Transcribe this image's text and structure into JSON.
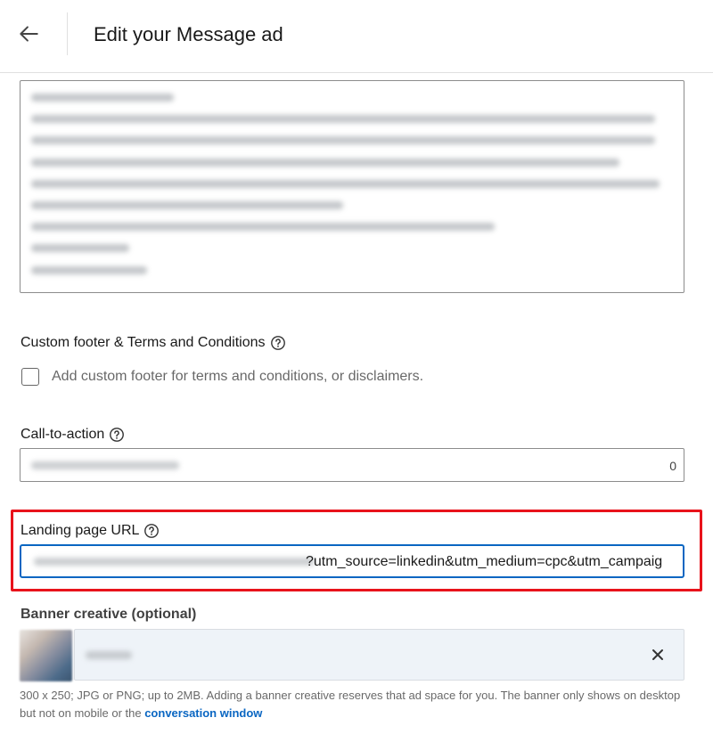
{
  "header": {
    "title": "Edit your Message ad",
    "back_icon": "arrow-left-icon"
  },
  "custom_footer": {
    "label": "Custom footer & Terms and Conditions",
    "checkbox_label": "Add custom footer for terms and conditions, or disclaimers.",
    "checked": false
  },
  "call_to_action": {
    "label": "Call-to-action",
    "char_count": "0"
  },
  "landing_page": {
    "label": "Landing page URL",
    "url_visible_text": "?utm_source=linkedin&utm_medium=cpc&utm_campaig"
  },
  "banner": {
    "label": "Banner creative (optional)",
    "helper_text": "300 x 250; JPG or PNG; up to 2MB. Adding a banner creative reserves that ad space for you. The banner only shows on desktop but not on mobile or the ",
    "helper_link": "conversation window"
  },
  "colors": {
    "accent": "#0a66c2",
    "highlight": "#e8131b"
  }
}
